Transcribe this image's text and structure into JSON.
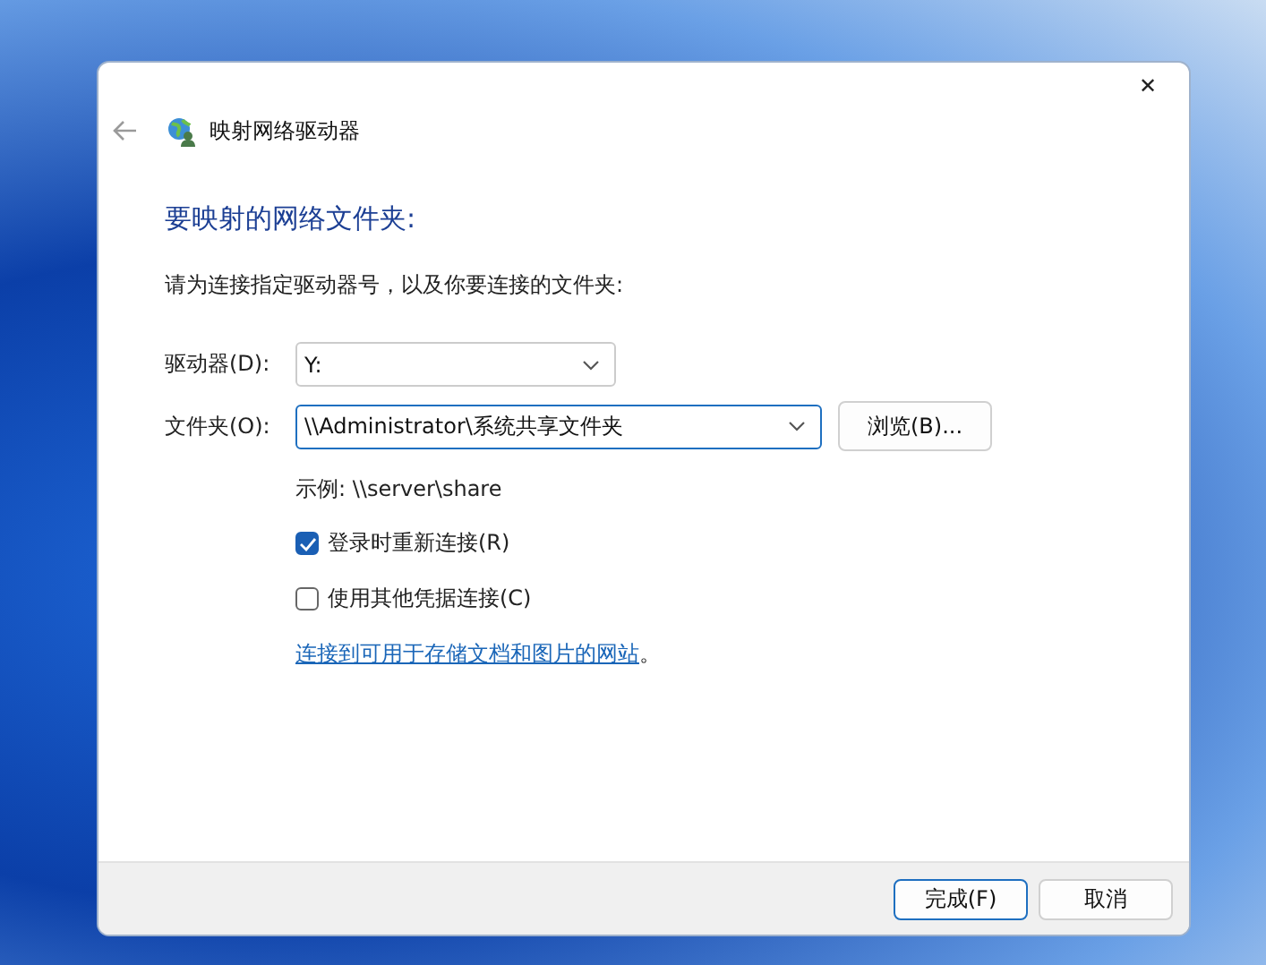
{
  "window": {
    "title": "映射网络驱动器",
    "close": "✕"
  },
  "heading": "要映射的网络文件夹:",
  "instruction": "请为连接指定驱动器号，以及你要连接的文件夹:",
  "fields": [
    {
      "label": "驱动器(D):",
      "value": "Y:"
    },
    {
      "label": "文件夹(O):",
      "value": "\\\\Administrator\\系统共享文件夹",
      "button": "浏览(B)..."
    }
  ],
  "example": "示例: \\\\server\\share",
  "checkboxes": [
    {
      "label": "登录时重新连接(R)",
      "checked": true
    },
    {
      "label": "使用其他凭据连接(C)",
      "checked": false
    }
  ],
  "link": {
    "text": "连接到可用于存储文档和图片的网站",
    "suffix": "。"
  },
  "buttons": [
    {
      "label": "完成(F)",
      "default": true
    },
    {
      "label": "取消",
      "default": false
    }
  ]
}
